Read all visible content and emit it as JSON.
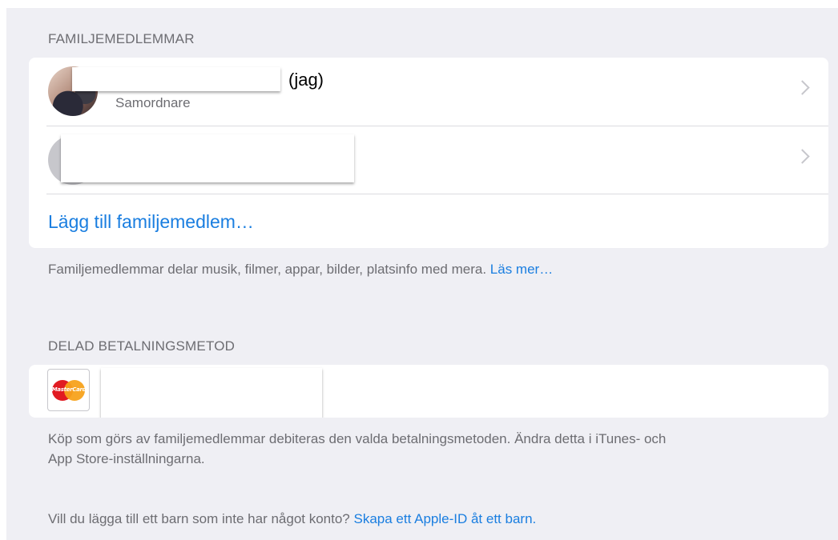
{
  "family": {
    "header": "FAMILJEMEDLEMMAR",
    "members": [
      {
        "name_suffix": "(jag)",
        "role": "Samordnare"
      },
      {
        "name_suffix": "",
        "role": ""
      }
    ],
    "add_label": "Lägg till familjemedlem…",
    "footer_text": "Familjemedlemmar delar musik, filmer, appar, bilder, platsinfo med mera.",
    "footer_link": "Läs mer…"
  },
  "payment": {
    "header": "DELAD BETALNINGSMETOD",
    "card_brand": "MasterCard",
    "footer_line1": "Köp som görs av familjemedlemmar debiteras den valda betalningsmetoden. Ändra detta i iTunes- och",
    "footer_line2": "App Store-inställningarna."
  },
  "child": {
    "question": "Vill du lägga till ett barn som inte har något konto?",
    "link": "Skapa ett Apple-ID åt ett barn."
  },
  "colors": {
    "background": "#efeff4",
    "link": "#1a7ee0",
    "secondary_text": "#6d6d72",
    "mastercard_red": "#e11b22",
    "mastercard_yellow": "#f7a21b"
  }
}
